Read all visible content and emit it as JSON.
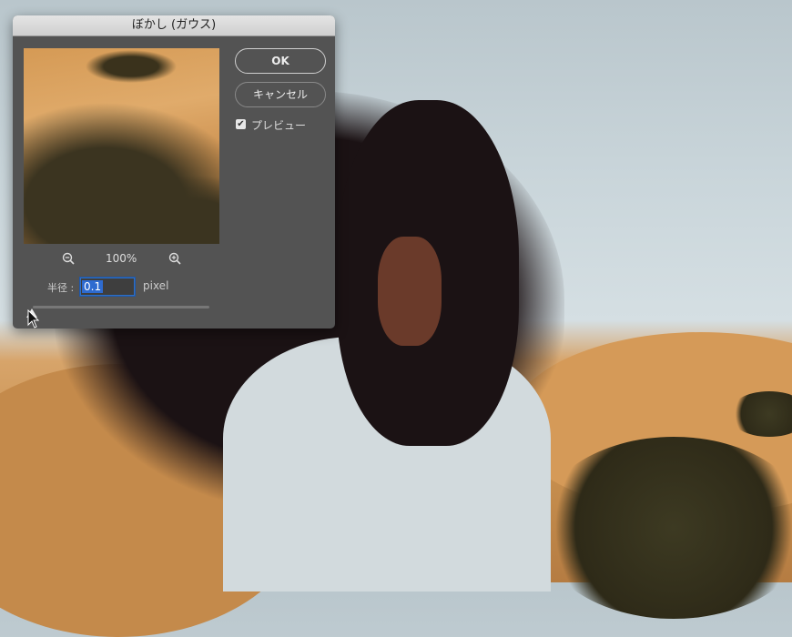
{
  "dialog": {
    "title": "ぼかし (ガウス)",
    "ok_label": "OK",
    "cancel_label": "キャンセル",
    "preview_label": "プレビュー",
    "preview_checked": true,
    "zoom_level": "100%",
    "zoom_out_icon": "zoom-out-icon",
    "zoom_in_icon": "zoom-in-icon",
    "radius_label": "半径 :",
    "radius_value": "0.1",
    "radius_unit": "pixel",
    "radius_slider_fraction": 0.0
  },
  "colors": {
    "dialog_bg": "#535353",
    "focus": "#2e6bd0"
  }
}
